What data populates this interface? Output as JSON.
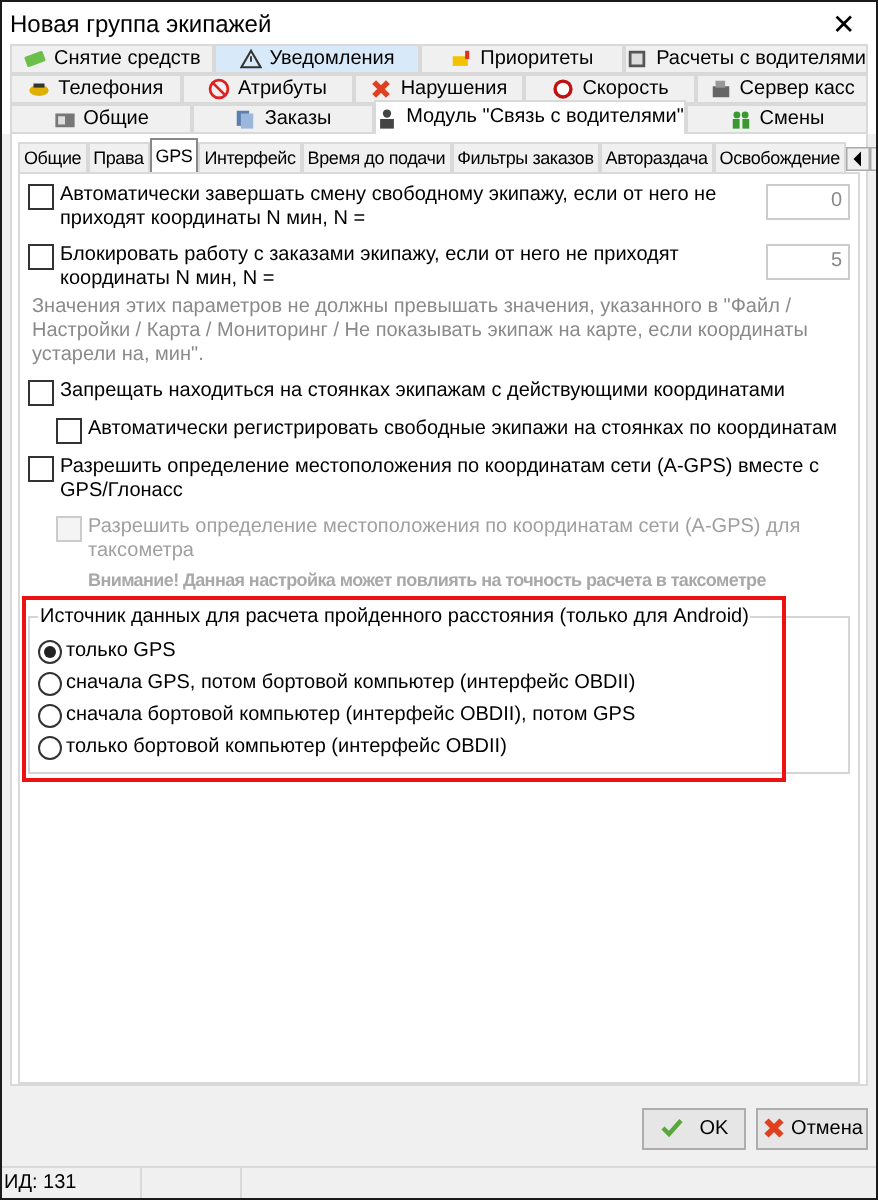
{
  "window": {
    "title": "Новая группа экипажей",
    "close": "✕"
  },
  "tab_rows": [
    [
      {
        "label": "Снятие средств",
        "selected": false,
        "hover": false
      },
      {
        "label": "Уведомления",
        "selected": false,
        "hover": true
      },
      {
        "label": "Приоритеты",
        "selected": false,
        "hover": false
      },
      {
        "label": "Расчеты с водителями",
        "selected": false,
        "hover": false
      }
    ],
    [
      {
        "label": "Телефония",
        "selected": false,
        "hover": false
      },
      {
        "label": "Атрибуты",
        "selected": false,
        "hover": false
      },
      {
        "label": "Нарушения",
        "selected": false,
        "hover": false
      },
      {
        "label": "Скорость",
        "selected": false,
        "hover": false
      },
      {
        "label": "Сервер касс",
        "selected": false,
        "hover": false
      }
    ],
    [
      {
        "label": "Общие",
        "selected": false,
        "hover": false
      },
      {
        "label": "Заказы",
        "selected": false,
        "hover": false
      },
      {
        "label": "Модуль \"Связь с водителями\"",
        "selected": true,
        "hover": false
      },
      {
        "label": "Смены",
        "selected": false,
        "hover": false
      }
    ]
  ],
  "subtabs": [
    {
      "label": "Общие",
      "selected": false
    },
    {
      "label": "Права",
      "selected": false
    },
    {
      "label": "GPS",
      "selected": true
    },
    {
      "label": "Интерфейс",
      "selected": false
    },
    {
      "label": "Время до подачи",
      "selected": false
    },
    {
      "label": "Фильтры заказов",
      "selected": false
    },
    {
      "label": "Автораздача",
      "selected": false
    },
    {
      "label": "Освобождение",
      "selected": false
    }
  ],
  "settings": [
    {
      "kind": "checkbox",
      "label": "Автоматически завершать смену свободному экипажу, если от него не приходят координаты N мин, N =",
      "checked": false,
      "disabled": false,
      "value": "0"
    },
    {
      "kind": "checkbox",
      "label": "Блокировать работу с заказами экипажу, если от него не приходят координаты N мин, N =",
      "checked": false,
      "disabled": false,
      "value": "5"
    },
    {
      "kind": "note",
      "label": "Значения этих параметров не должны превышать значения, указанного в \"Файл / Настройки / Карта / Мониторинг / Не показывать экипаж на карте, если координаты устарели на, мин\"."
    },
    {
      "kind": "checkbox",
      "label": "Запрещать находиться на стоянках экипажам с действующими координатами",
      "checked": false,
      "disabled": false,
      "children": [
        {
          "kind": "checkbox",
          "label": "Автоматически регистрировать свободные экипажи на стоянках по координатам",
          "checked": false,
          "disabled": false
        }
      ]
    },
    {
      "kind": "checkbox",
      "label": "Разрешить определение местоположения по координатам сети (A-GPS) вместе с GPS/Глонасс",
      "checked": false,
      "disabled": false,
      "children": [
        {
          "kind": "checkbox",
          "label": "Разрешить определение местоположения по координатам сети (A-GPS) для таксометра",
          "checked": false,
          "disabled": true
        },
        {
          "kind": "warning",
          "label": "Внимание! Данная настройка может повлиять на точность расчета в таксометре"
        }
      ]
    }
  ],
  "distance_source": {
    "title": "Источник данных для расчета пройденного расстояния (только для Android)",
    "options": [
      {
        "label": "только GPS",
        "selected": true
      },
      {
        "label": "сначала GPS, потом бортовой компьютер (интерфейс OBDII)",
        "selected": false
      },
      {
        "label": "сначала бортовой компьютер (интерфейс OBDII), потом GPS",
        "selected": false
      },
      {
        "label": "только бортовой компьютер (интерфейс OBDII)",
        "selected": false
      }
    ]
  },
  "buttons": [
    {
      "label": "OK",
      "kind": "confirm"
    },
    {
      "label": "Отмена",
      "kind": "cancel"
    }
  ],
  "status_bar": [
    "ИД: 131"
  ]
}
